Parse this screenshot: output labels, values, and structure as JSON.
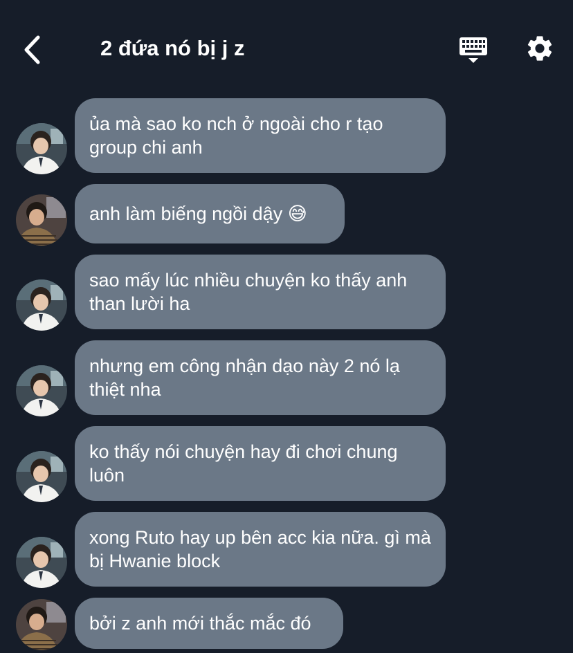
{
  "header": {
    "title": "2 đứa nó bị j z",
    "back_icon": "chevron-left-icon",
    "keyboard_icon": "keyboard-icon",
    "settings_icon": "gear-icon"
  },
  "messages": [
    {
      "text": "ủa mà sao ko nch ở ngoài cho r tạo group chi anh",
      "avatar": "avatar-a"
    },
    {
      "text": "anh làm biếng ngồi dậy 😅",
      "avatar": "avatar-b"
    },
    {
      "text": "sao mấy lúc nhiều chuyện ko thấy anh than lười ha",
      "avatar": "avatar-a"
    },
    {
      "text": "nhưng em công nhận dạo này 2 nó lạ thiệt nha",
      "avatar": "avatar-a"
    },
    {
      "text": "ko thấy nói chuyện hay đi chơi chung luôn",
      "avatar": "avatar-a"
    },
    {
      "text": "xong Ruto hay up bên acc kia nữa. gì mà bị Hwanie block",
      "avatar": "avatar-a"
    },
    {
      "text": "bởi z anh mới thắc mắc đó",
      "avatar": "avatar-b"
    }
  ],
  "colors": {
    "background": "#161d29",
    "bubble": "#6b7887",
    "text": "#ffffff"
  }
}
